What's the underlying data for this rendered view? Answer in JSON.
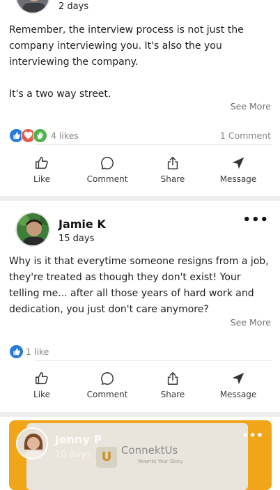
{
  "post1": {
    "time": "2 days",
    "body": "Remember, the interview process is not just the company interviewing you. It's also the you interviewing the company.\n\nIt's a two way street.",
    "see_more": "See More",
    "likes": "4 likes",
    "comments": "1 Comment"
  },
  "post2": {
    "author": "Jamie K",
    "time": "15 days",
    "more": "•••",
    "body": "Why is it that everytime someone resigns from a job, they're treated as though they don't exist! Your telling me... after all those years of hard work and dedication, you just don't care anymore?",
    "see_more": "See More",
    "likes": "1 like"
  },
  "post3": {
    "author": "Jenny P",
    "time": "10 days",
    "more": "•••",
    "brand": "ConnektUs",
    "brand_mark": "U",
    "tagline": "Rewrite Your Story."
  },
  "actions": {
    "like": "Like",
    "comment": "Comment",
    "share": "Share",
    "message": "Message"
  },
  "icons": {
    "like": "thumbs-up-icon",
    "comment": "speech-bubble-icon",
    "share": "share-upload-icon",
    "message": "paper-plane-icon",
    "reaction_like": "blue-thumbs-up",
    "reaction_love": "red-heart",
    "reaction_clap": "green-clap"
  },
  "colors": {
    "reaction_like": "#2a7bd6",
    "reaction_love": "#e85b4a",
    "reaction_clap": "#4fb24a",
    "story_bg": "#f1a518"
  }
}
